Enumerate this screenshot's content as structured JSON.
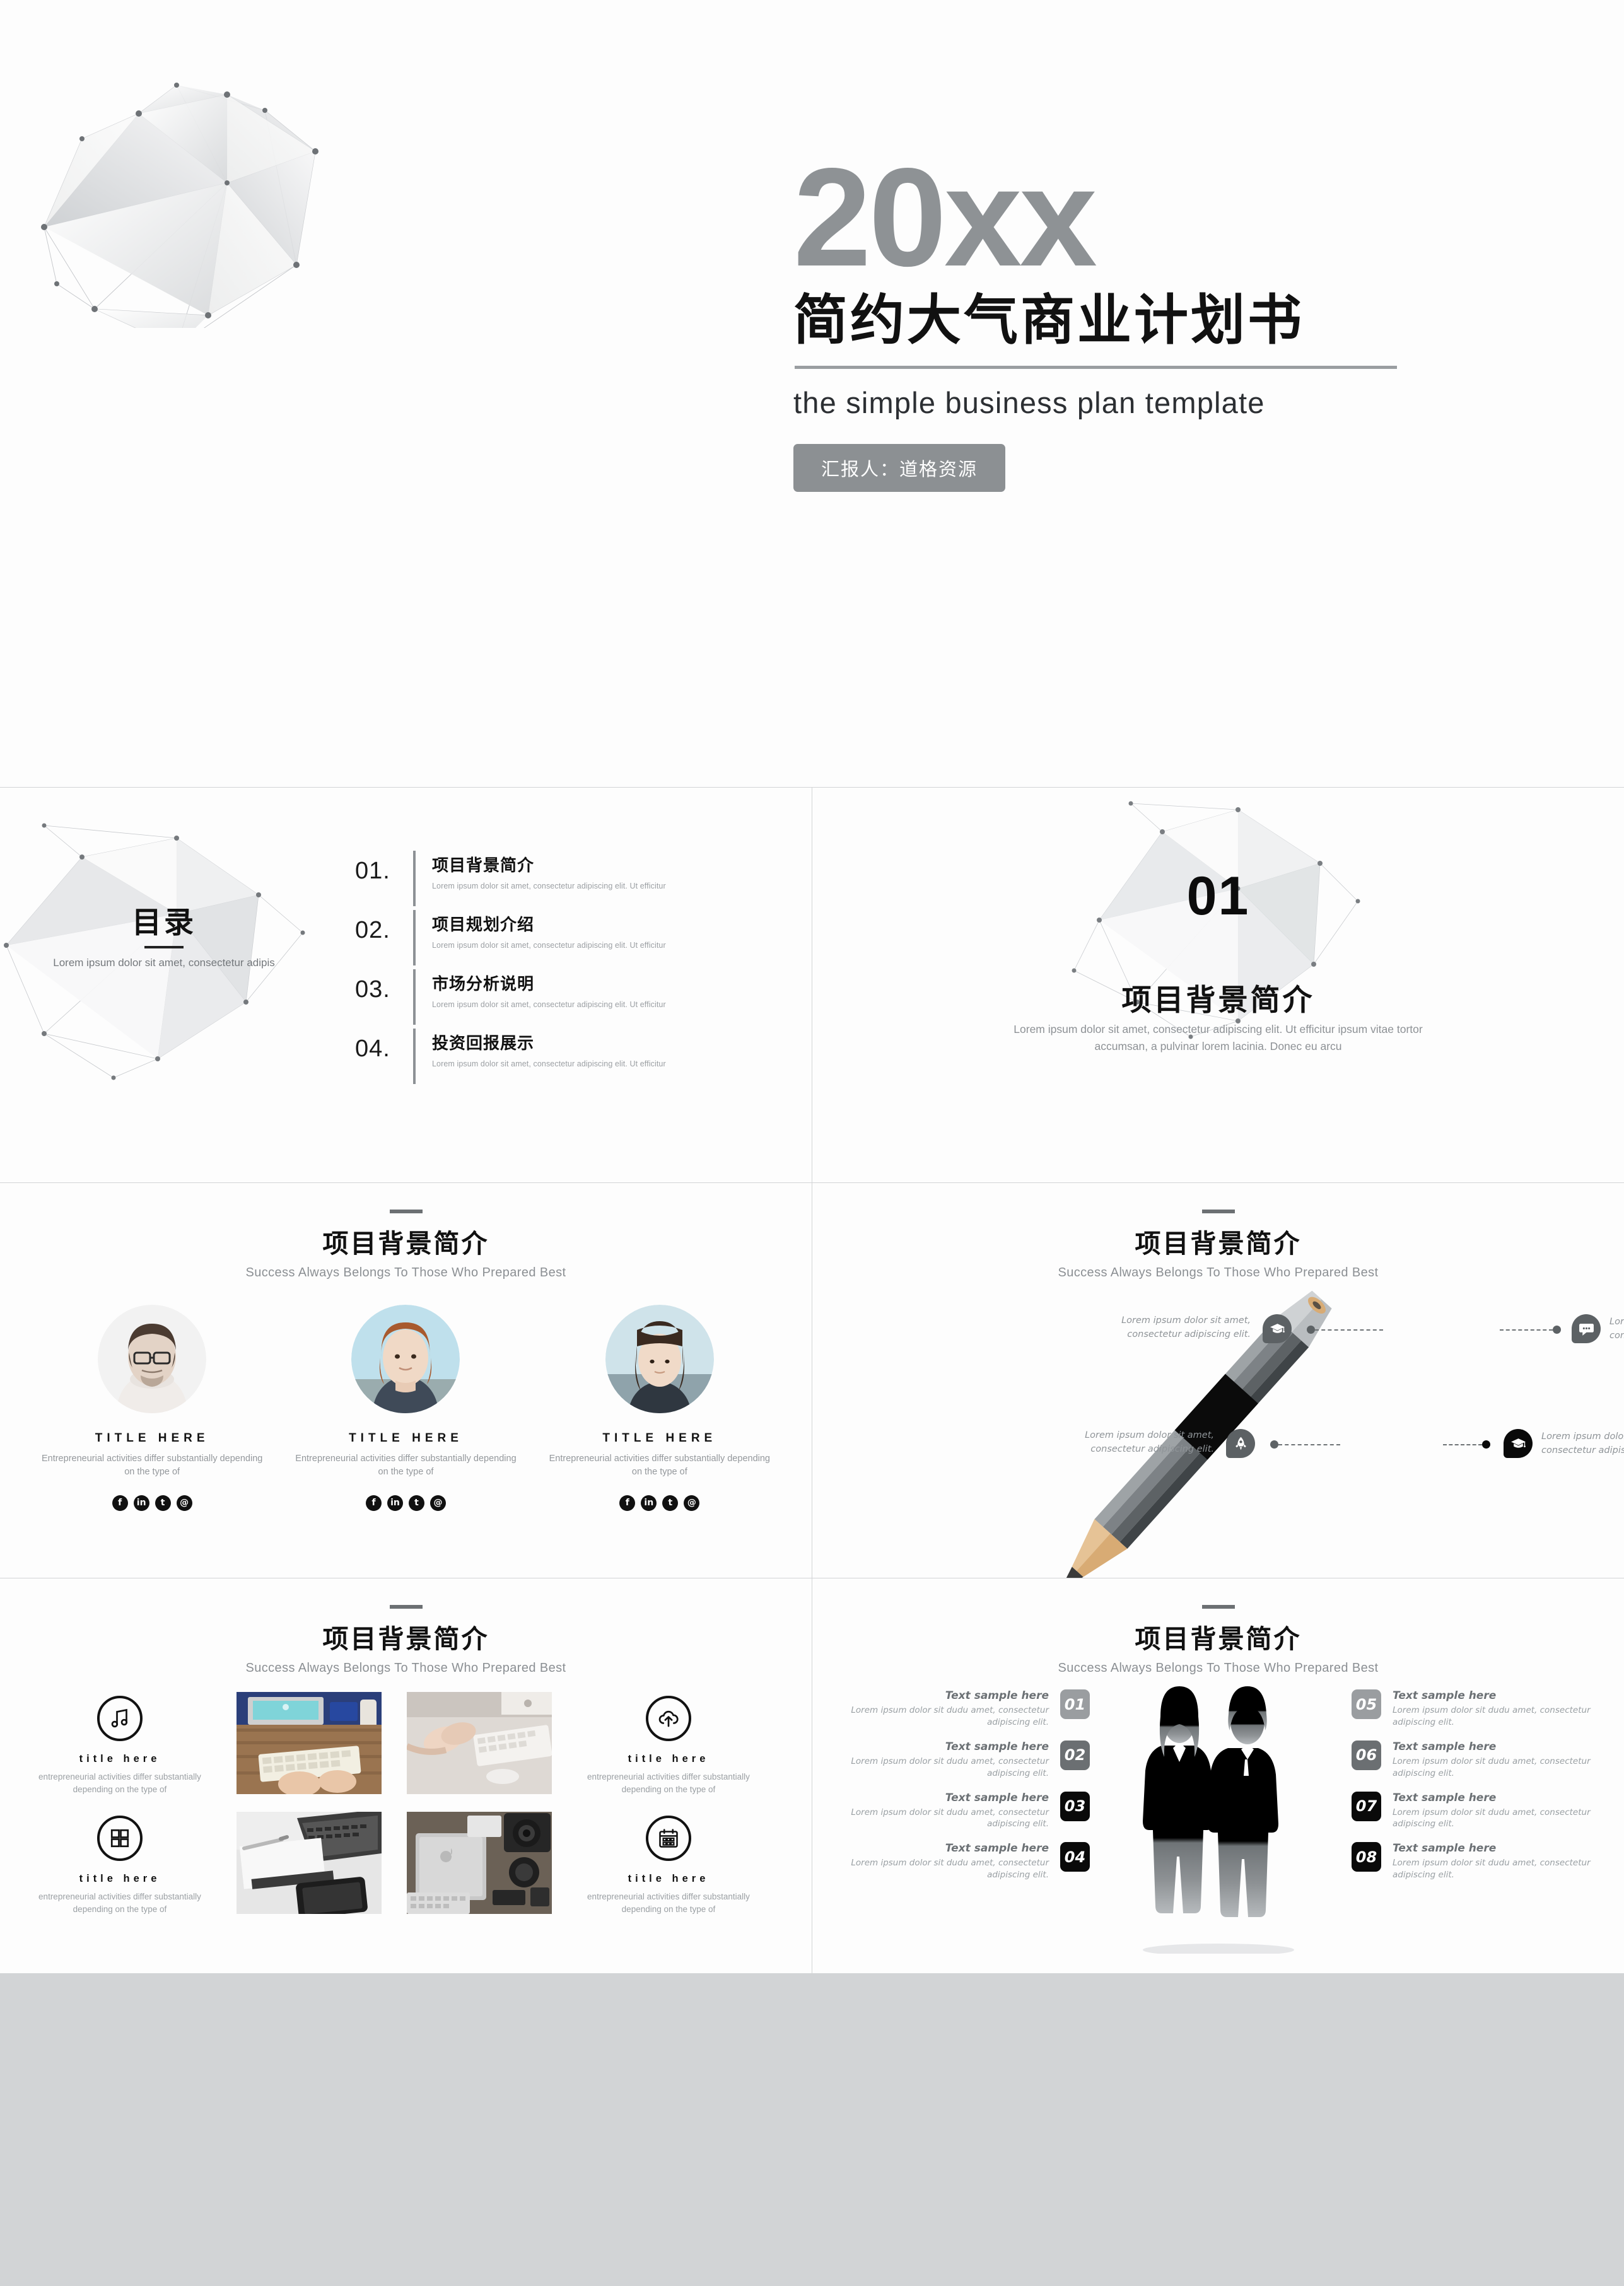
{
  "title_slide": {
    "year": "20xx",
    "title_cn": "简约大气商业计划书",
    "subtitle_en": "the simple business plan template",
    "presenter_badge": "汇报人：道格资源"
  },
  "toc_slide": {
    "heading": "目录",
    "heading_sub": "Lorem ipsum dolor sit amet, consectetur adipis",
    "items": [
      {
        "num": "01.",
        "title": "项目背景简介",
        "desc": "Lorem ipsum dolor sit amet, consectetur adipiscing elit. Ut efficitur"
      },
      {
        "num": "02.",
        "title": "项目规划介绍",
        "desc": "Lorem ipsum dolor sit amet, consectetur adipiscing elit. Ut efficitur"
      },
      {
        "num": "03.",
        "title": "市场分析说明",
        "desc": "Lorem ipsum dolor sit amet, consectetur adipiscing elit. Ut efficitur"
      },
      {
        "num": "04.",
        "title": "投资回报展示",
        "desc": "Lorem ipsum dolor sit amet, consectetur adipiscing elit. Ut efficitur"
      }
    ]
  },
  "section_slide": {
    "number": "01",
    "title": "项目背景简介",
    "desc": "Lorem ipsum dolor sit amet, consectetur adipiscing elit. Ut efficitur ipsum vitae tortor accumsan, a pulvinar lorem lacinia. Donec eu arcu"
  },
  "common_header": {
    "title": "项目背景简介",
    "subtitle": "Success Always Belongs To Those Who Prepared Best"
  },
  "team_slide": {
    "members": [
      {
        "title": "TITLE HERE",
        "desc": "Entrepreneurial activities differ substantially depending on the type of"
      },
      {
        "title": "TITLE HERE",
        "desc": "Entrepreneurial activities differ substantially depending on the type of"
      },
      {
        "title": "TITLE HERE",
        "desc": "Entrepreneurial activities differ substantially depending on the type of"
      }
    ],
    "social_icons": [
      "facebook-icon",
      "linkedin-icon",
      "twitter-icon",
      "email-icon"
    ],
    "social_glyphs": [
      "f",
      "in",
      "t",
      "@"
    ]
  },
  "pencil_slide": {
    "callouts": [
      {
        "icon": "graduation-cap-icon",
        "text": "Lorem ipsum dolor sit amet, consectetur adipiscing elit."
      },
      {
        "icon": "chat-bubble-icon",
        "text": "Lorem ipsum dolor sit amet, consectetur adipiscing elit."
      },
      {
        "icon": "rocket-icon",
        "text": "Lorem ipsum dolor sit amet, consectetur adipiscing elit."
      },
      {
        "icon": "graduation-cap-icon",
        "text": "Lorem ipsum dolor sit amet, consectetur adipiscing elit."
      }
    ]
  },
  "icon_grid_slide": {
    "cells": [
      {
        "icon": "music-note-icon",
        "title": "title here",
        "desc": "entrepreneurial activities differ substantially depending on the type of"
      },
      {
        "icon": "cloud-upload-icon",
        "title": "title here",
        "desc": "entrepreneurial activities differ substantially depending on the type of"
      },
      {
        "icon": "grid-squares-icon",
        "title": "title here",
        "desc": "entrepreneurial activities differ substantially depending on the type of"
      },
      {
        "icon": "calendar-icon",
        "title": "title here",
        "desc": "entrepreneurial activities differ substantially depending on the type of"
      }
    ],
    "photos": [
      "desk-imac-keyboard-photo",
      "hands-keyboard-mouse-photo",
      "pen-notebook-laptop-photo",
      "laptop-camera-gear-photo"
    ]
  },
  "numbered_slide": {
    "left_items": [
      {
        "num": "01",
        "color": "#9a9da0",
        "title": "Text sample here",
        "desc": "Lorem ipsum dolor sit dudu amet, consectetur adipiscing elit."
      },
      {
        "num": "02",
        "color": "#6b6f72",
        "title": "Text sample here",
        "desc": "Lorem ipsum dolor sit dudu amet, consectetur adipiscing elit."
      },
      {
        "num": "03",
        "color": "#0a0a0a",
        "title": "Text sample here",
        "desc": "Lorem ipsum dolor sit dudu amet, consectetur adipiscing elit."
      },
      {
        "num": "04",
        "color": "#0a0a0a",
        "title": "Text sample here",
        "desc": "Lorem ipsum dolor sit dudu amet, consectetur adipiscing elit."
      }
    ],
    "right_items": [
      {
        "num": "05",
        "color": "#9a9da0",
        "title": "Text sample here",
        "desc": "Lorem ipsum dolor sit dudu amet, consectetur adipiscing elit."
      },
      {
        "num": "06",
        "color": "#6b6f72",
        "title": "Text sample here",
        "desc": "Lorem ipsum dolor sit dudu amet, consectetur adipiscing elit."
      },
      {
        "num": "07",
        "color": "#0a0a0a",
        "title": "Text sample here",
        "desc": "Lorem ipsum dolor sit dudu amet, consectetur adipiscing elit."
      },
      {
        "num": "08",
        "color": "#0a0a0a",
        "title": "Text sample here",
        "desc": "Lorem ipsum dolor sit dudu amet, consectetur adipiscing elit."
      }
    ],
    "illustration": "business-people-silhouette"
  },
  "colors": {
    "accent_gray": "#8e9295",
    "text_dark": "#111111",
    "text_muted": "#9aa0a4",
    "slide_bg": "#fdfdfd",
    "gap": "#d2d4d6"
  }
}
